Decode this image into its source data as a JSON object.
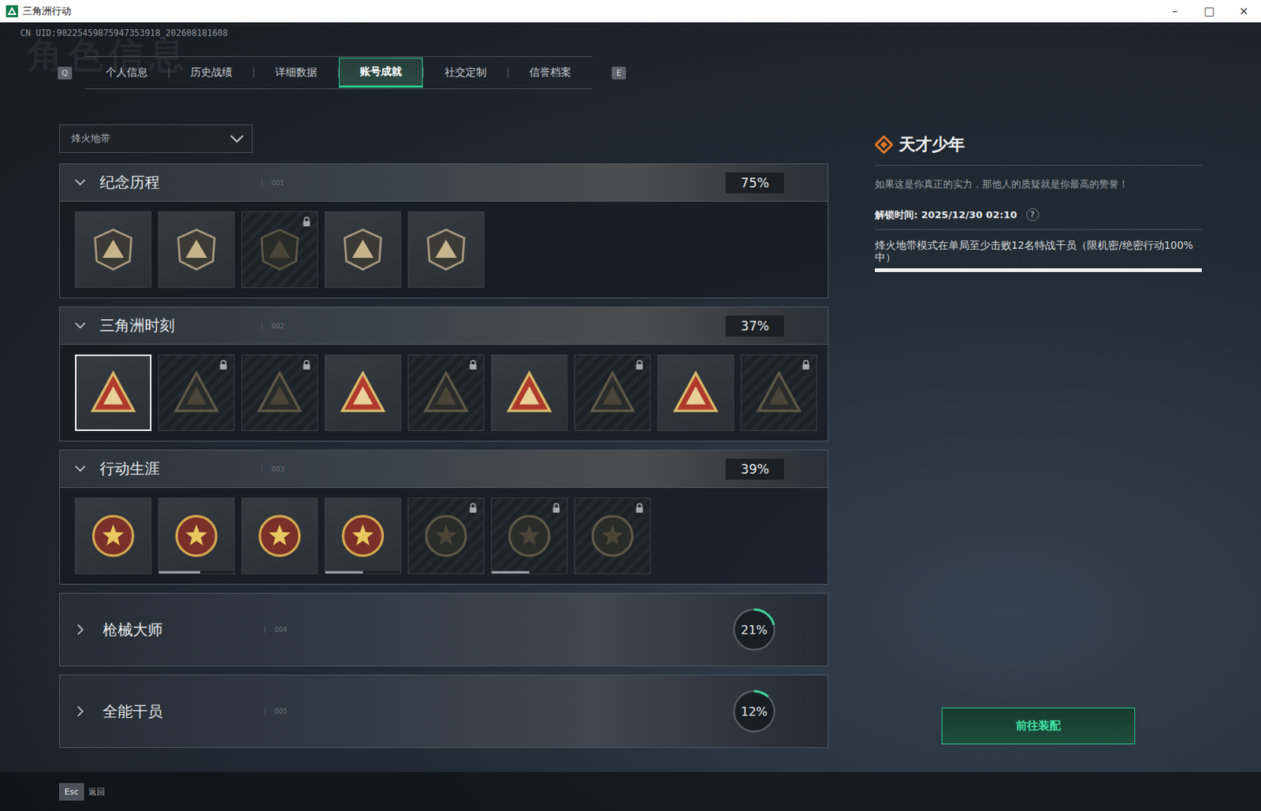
{
  "window": {
    "title": "三角洲行动",
    "controls": [
      "–",
      "□",
      "×"
    ]
  },
  "uid": "CN UID:90225459875947353918_202608181608",
  "watermark": "角色信息",
  "tabs": {
    "prev_key": "Q",
    "next_key": "E",
    "items": [
      {
        "label": "个人信息",
        "selected": false
      },
      {
        "label": "历史战绩",
        "selected": false
      },
      {
        "label": "详细数据",
        "selected": false
      },
      {
        "label": "账号成就",
        "selected": true
      },
      {
        "label": "社交定制",
        "selected": false
      },
      {
        "label": "信誉档案",
        "selected": false
      }
    ]
  },
  "mode_select": {
    "value": "烽火地带"
  },
  "sections": [
    {
      "title": "纪念历程",
      "number": "001",
      "percent": "75%",
      "expanded": true,
      "kind": "shield",
      "badges": [
        {
          "locked": false,
          "selected": false
        },
        {
          "locked": false,
          "selected": false
        },
        {
          "locked": true,
          "selected": false
        },
        {
          "locked": false,
          "selected": false
        },
        {
          "locked": false,
          "selected": false
        }
      ]
    },
    {
      "title": "三角洲时刻",
      "number": "002",
      "percent": "37%",
      "expanded": true,
      "kind": "triangle",
      "badges": [
        {
          "locked": false,
          "selected": true
        },
        {
          "locked": true,
          "selected": false
        },
        {
          "locked": true,
          "selected": false
        },
        {
          "locked": false,
          "selected": false
        },
        {
          "locked": true,
          "selected": false
        },
        {
          "locked": false,
          "selected": false
        },
        {
          "locked": true,
          "selected": false
        },
        {
          "locked": false,
          "selected": false
        },
        {
          "locked": true,
          "selected": false
        }
      ]
    },
    {
      "title": "行动生涯",
      "number": "003",
      "percent": "39%",
      "expanded": true,
      "kind": "medal",
      "badges": [
        {
          "locked": false,
          "selected": false
        },
        {
          "locked": false,
          "selected": false,
          "level": 0.55
        },
        {
          "locked": false,
          "selected": false
        },
        {
          "locked": false,
          "selected": false,
          "level": 0.5
        },
        {
          "locked": true,
          "selected": false
        },
        {
          "locked": true,
          "selected": false,
          "level": 0.5
        },
        {
          "locked": true,
          "selected": false
        }
      ]
    },
    {
      "title": "枪械大师",
      "number": "004",
      "percent": "21%",
      "expanded": false,
      "kind": "ring",
      "level": 0.21,
      "badges": []
    },
    {
      "title": "全能干员",
      "number": "005",
      "percent": "12%",
      "expanded": false,
      "kind": "ring",
      "level": 0.12,
      "badges": []
    }
  ],
  "detail": {
    "title": "天才少年",
    "description": "如果这是你真正的实力，那他人的质疑就是你最高的赞誉！",
    "unlock_label": "解锁时间: 2025/12/30 02:10",
    "help": "?",
    "requirement": "烽火地带模式在单局至少击败12名特战干员（限机密/绝密行动100%中）",
    "level": 1,
    "button": "前往装配"
  },
  "footer": {
    "key": "Esc",
    "label": "返回"
  }
}
